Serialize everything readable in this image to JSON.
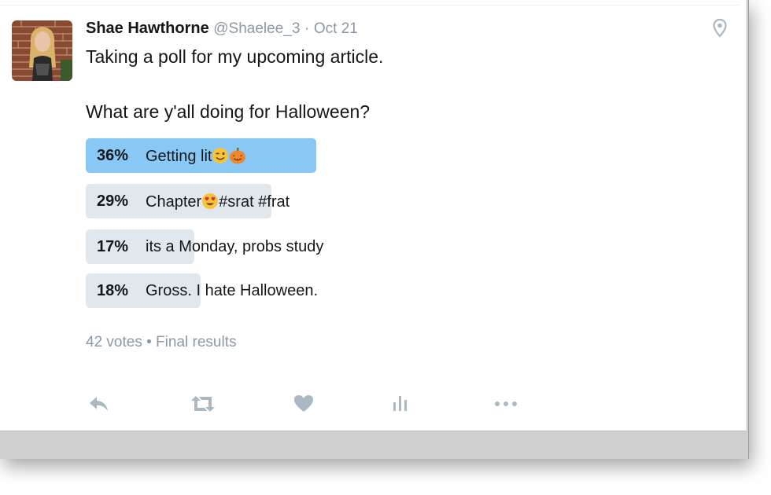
{
  "tweet": {
    "author_name": "Shae Hawthorne",
    "handle": "@Shaelee_3",
    "separator": "·",
    "date": "Oct 21",
    "line1": "Taking a poll for my upcoming article.",
    "line2": "What are y'all doing for Halloween?"
  },
  "poll": {
    "options": [
      {
        "percent_text": "36%",
        "percent": 36,
        "label_before": "Getting lit",
        "label_after": "",
        "emoji": [
          "winking-face",
          "jack-o-lantern"
        ],
        "winner": true
      },
      {
        "percent_text": "29%",
        "percent": 29,
        "label_before": "Chapter",
        "label_after": "#srat #frat",
        "emoji": [
          "heart-eyes-face"
        ],
        "winner": false
      },
      {
        "percent_text": "17%",
        "percent": 17,
        "label_before": "its a Monday, probs study",
        "label_after": "",
        "emoji": [],
        "winner": false
      },
      {
        "percent_text": "18%",
        "percent": 18,
        "label_before": "Gross. I hate Halloween.",
        "label_after": "",
        "emoji": [],
        "winner": false
      }
    ],
    "votes_text": "42 votes",
    "bullet": "•",
    "status_text": "Final results"
  },
  "actions": [
    "reply-icon",
    "retweet-icon",
    "like-icon",
    "analytics-icon",
    "more-icon"
  ],
  "colors": {
    "winner_fill": "#89c8f4",
    "loser_fill": "#e1e8ed",
    "meta_gray": "#8b98a5",
    "icon_gray": "#aab8c2",
    "text": "#14171a"
  }
}
